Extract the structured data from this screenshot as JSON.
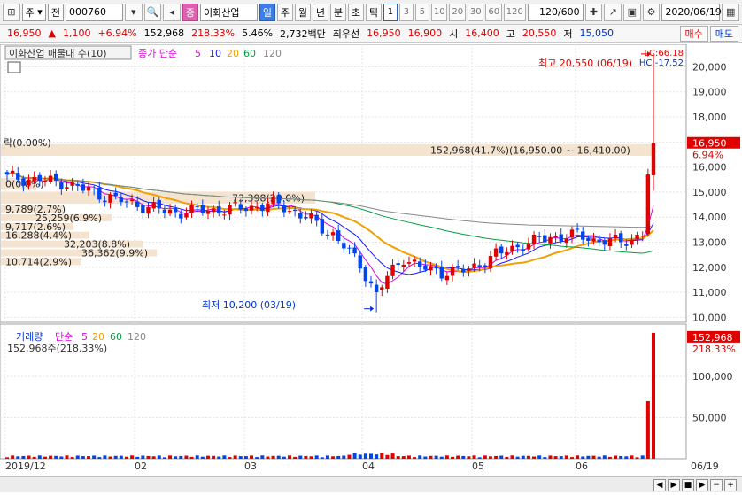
{
  "toolbar": {
    "market": "주",
    "type": "전",
    "code": "000760",
    "badge": "증",
    "name": "이화산업",
    "periods": [
      "일",
      "주",
      "월",
      "년",
      "분",
      "초",
      "틱"
    ],
    "active_period": "일",
    "minute_nums": [
      "1",
      "3",
      "5",
      "10",
      "20",
      "30",
      "60",
      "120"
    ],
    "count": "120/600",
    "date": "2020/06/19"
  },
  "quote": {
    "price": "16,950",
    "change": "1,100",
    "change_pct": "+6.94%",
    "volume": "152,968",
    "volume_ratio": "218.33%",
    "turnover": "5.46%",
    "amount": "2,732백만",
    "pref_label": "최우선",
    "ask": "16,950",
    "bid": "16,900",
    "open_label": "시",
    "open": "16,400",
    "high_label": "고",
    "high": "20,550",
    "low_label": "저",
    "low": "15,050",
    "buy": "매수",
    "sell": "매도"
  },
  "price_panel": {
    "legend_title": "이화산업 매물대 수(10)",
    "ma_label": "종가 단순",
    "ma_periods": [
      "5",
      "10",
      "20",
      "60",
      "120"
    ],
    "ma_colors": [
      "#e000e0",
      "#1a1aff",
      "#f0a000",
      "#00a040",
      "#888888"
    ],
    "lc_label": "LC:66.18",
    "hc_label": "HC:-17.52",
    "high_note": "최고 20,550 (06/19)",
    "low_note": "최저 10,200 (03/19)",
    "cur_price_tag": "16,950",
    "cur_pct_tag": "6.94%",
    "profile_labels": [
      "락(0.00%)",
      "0(0.0%)",
      "152,968(41.7%)(16,950.00 ~ 16,410.00)",
      "73,398(20.0%)",
      "9,789(2.7%)",
      "25,259(6.9%)",
      "9,717(2.6%)",
      "16,288(4.4%)",
      "32,203(8.8%)",
      "36,362(9.9%)",
      "10,714(2.9%)"
    ]
  },
  "volume_panel": {
    "title": "거래량",
    "ma_label": "단순",
    "ma_periods": [
      "5",
      "20",
      "60",
      "120"
    ],
    "ma_colors": [
      "#e000e0",
      "#f0a000",
      "#00a040",
      "#888888"
    ],
    "current": "152,968주(218.33%)",
    "tag_value": "152,968",
    "tag_pct": "218.33%"
  },
  "x_axis": {
    "labels": [
      "2019/12",
      "02",
      "03",
      "04",
      "05",
      "06",
      "06/19"
    ]
  },
  "chart_data": {
    "type": "candlestick",
    "price_ticks": [
      10000,
      11000,
      12000,
      13000,
      14000,
      15000,
      16000,
      17000,
      18000,
      19000,
      20000
    ],
    "price_ylim": [
      9800,
      20900
    ],
    "volume_ticks": [
      50000,
      100000
    ],
    "volume_ylim": [
      0,
      155000
    ],
    "x_labels": [
      "2019/12",
      "02",
      "03",
      "04",
      "05",
      "06",
      "06/19"
    ],
    "high": 20550,
    "low": 10200,
    "last_close": 16950,
    "last_volume": 152968
  }
}
